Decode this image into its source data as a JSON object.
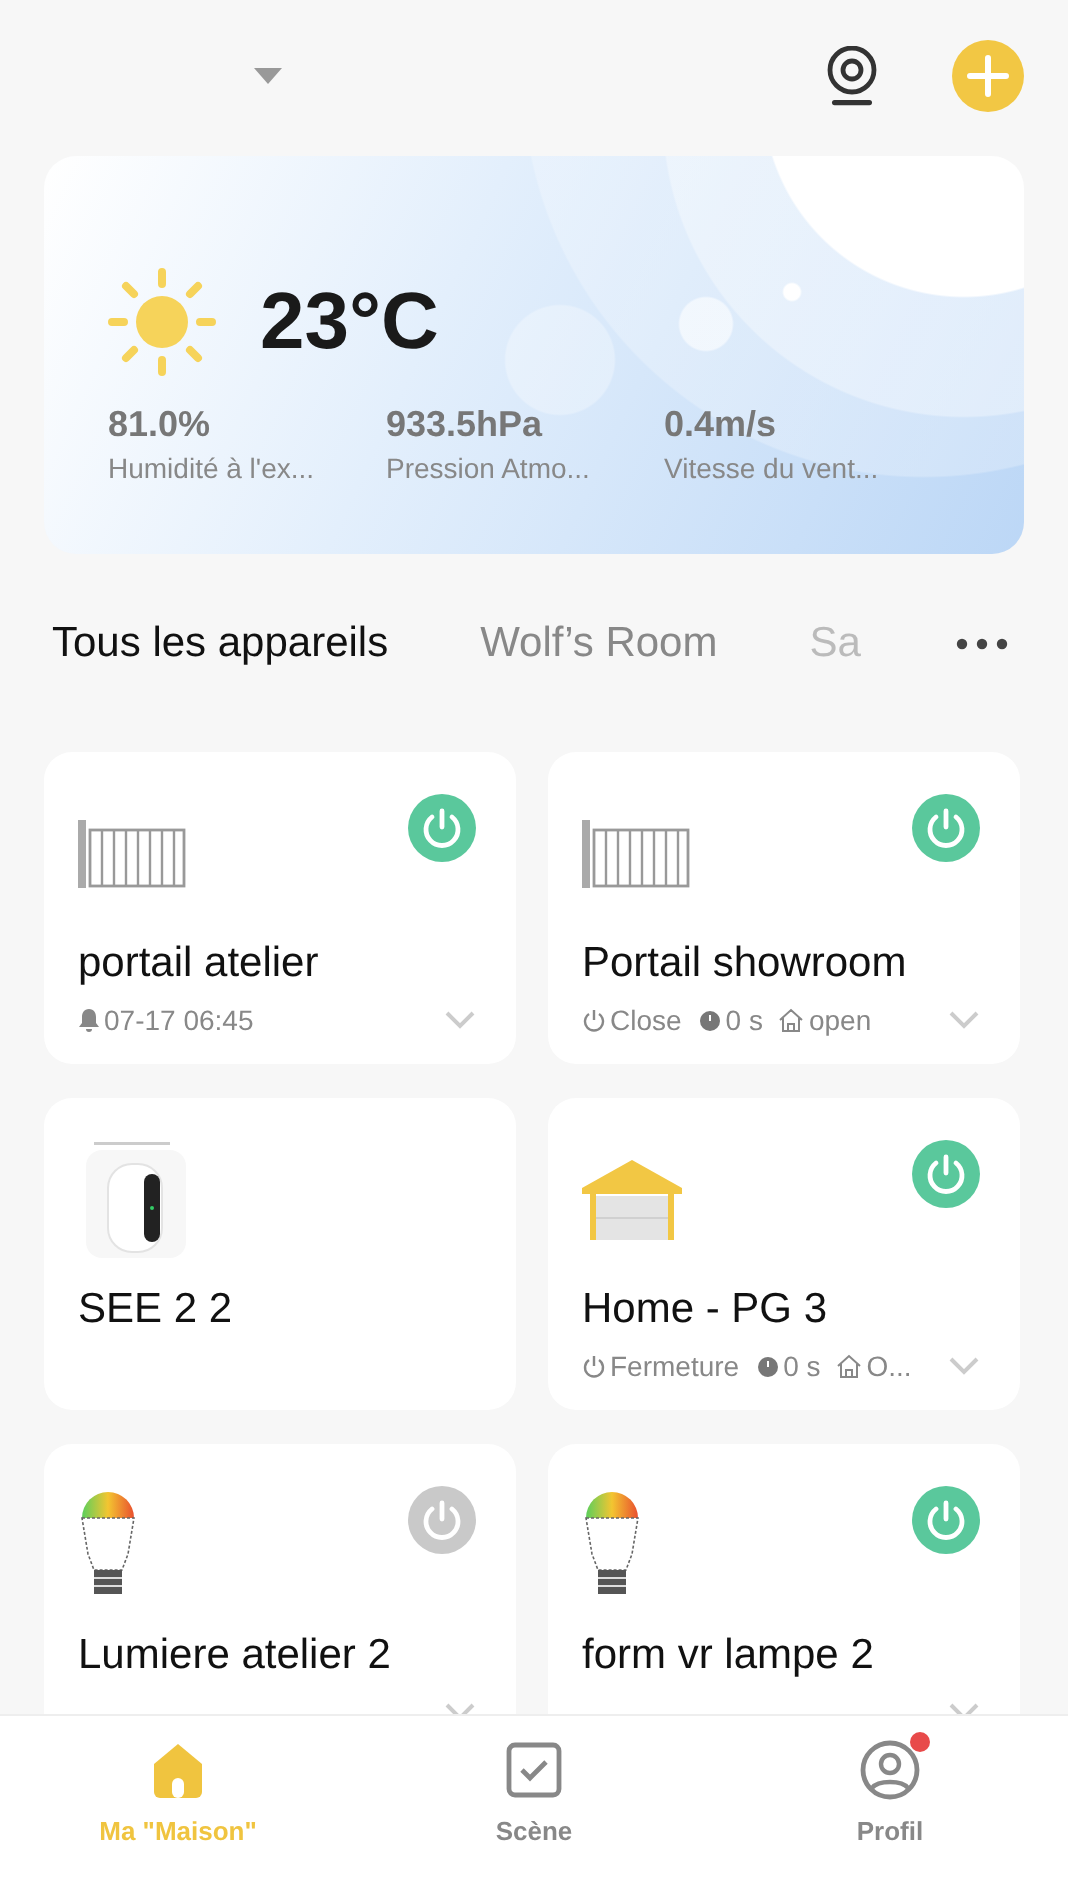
{
  "weather": {
    "temperature": "23°C",
    "stats": [
      {
        "value": "81.0%",
        "label": "Humidité à l'ex..."
      },
      {
        "value": "933.5hPa",
        "label": "Pression Atmo..."
      },
      {
        "value": "0.4m/s",
        "label": "Vitesse du vent..."
      }
    ]
  },
  "tabs": [
    {
      "label": "Tous les appareils",
      "selected": true
    },
    {
      "label": "Wolf’s Room",
      "selected": false
    },
    {
      "label": "Sa",
      "selected": false
    }
  ],
  "devices": [
    {
      "name": "portail atelier",
      "kind": "gate",
      "power": true,
      "status": [
        {
          "kind": "bell",
          "text": "07-17 06:45"
        }
      ]
    },
    {
      "name": "Portail showroom",
      "kind": "gate",
      "power": true,
      "status": [
        {
          "kind": "power",
          "text": "Close"
        },
        {
          "kind": "timer",
          "text": "0 s"
        },
        {
          "kind": "home",
          "text": "open"
        }
      ]
    },
    {
      "name": "SEE 2 2",
      "kind": "camera"
    },
    {
      "name": "Home - PG 3",
      "kind": "garage",
      "power": true,
      "status": [
        {
          "kind": "power",
          "text": "Fermeture"
        },
        {
          "kind": "timer",
          "text": "0 s"
        },
        {
          "kind": "home",
          "text": "O..."
        }
      ]
    },
    {
      "name": "Lumiere atelier 2",
      "kind": "bulb",
      "power": false
    },
    {
      "name": "form vr lampe 2",
      "kind": "bulb",
      "power": true
    }
  ],
  "nav": [
    {
      "label": "Ma \"Maison\"",
      "kind": "home",
      "selected": true,
      "badge": false
    },
    {
      "label": "Scène",
      "kind": "scene",
      "selected": false,
      "badge": false
    },
    {
      "label": "Profil",
      "kind": "profile",
      "selected": false,
      "badge": true
    }
  ]
}
